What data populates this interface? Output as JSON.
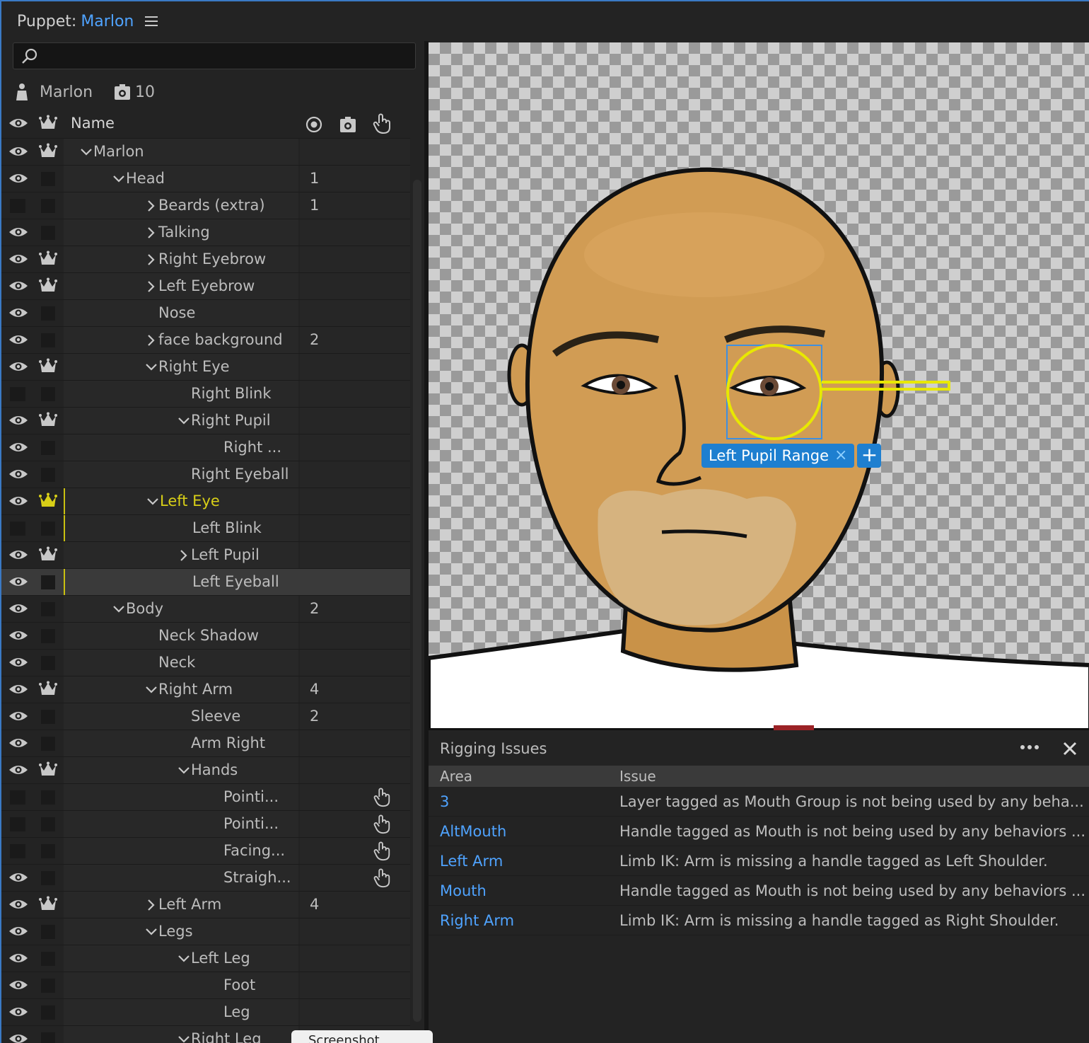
{
  "header": {
    "prefix": "Puppet:",
    "puppet_name": "Marlon"
  },
  "search": {
    "placeholder": ""
  },
  "puppet_info": {
    "name": "Marlon",
    "behaviors_count": "10"
  },
  "table": {
    "column_name": "Name",
    "rows": [
      {
        "label": "Marlon",
        "indent": 0,
        "chev": "down",
        "eye": true,
        "crown": true,
        "num": "",
        "hand": false
      },
      {
        "label": "Head",
        "indent": 1,
        "chev": "down",
        "eye": true,
        "crown": false,
        "num": "1",
        "hand": false
      },
      {
        "label": "Beards (extra)",
        "indent": 2,
        "chev": "right",
        "eye": false,
        "crown": false,
        "num": "1",
        "hand": false
      },
      {
        "label": "Talking",
        "indent": 2,
        "chev": "right",
        "eye": true,
        "crown": false,
        "num": "",
        "hand": false
      },
      {
        "label": "Right Eyebrow",
        "indent": 2,
        "chev": "right",
        "eye": true,
        "crown": true,
        "num": "",
        "hand": false
      },
      {
        "label": "Left Eyebrow",
        "indent": 2,
        "chev": "right",
        "eye": true,
        "crown": true,
        "num": "",
        "hand": false
      },
      {
        "label": "Nose",
        "indent": 2,
        "chev": "",
        "eye": true,
        "crown": false,
        "num": "",
        "hand": false
      },
      {
        "label": "face background",
        "indent": 2,
        "chev": "right",
        "eye": true,
        "crown": false,
        "num": "2",
        "hand": false
      },
      {
        "label": "Right Eye",
        "indent": 2,
        "chev": "down",
        "eye": true,
        "crown": true,
        "num": "",
        "hand": false
      },
      {
        "label": "Right Blink",
        "indent": 3,
        "chev": "",
        "eye": false,
        "crown": false,
        "num": "",
        "hand": false
      },
      {
        "label": "Right Pupil",
        "indent": 3,
        "chev": "down",
        "eye": true,
        "crown": true,
        "num": "",
        "hand": false
      },
      {
        "label": "Right ...",
        "indent": 4,
        "chev": "",
        "eye": true,
        "crown": false,
        "num": "",
        "hand": false
      },
      {
        "label": "Right Eyeball",
        "indent": 3,
        "chev": "",
        "eye": true,
        "crown": false,
        "num": "",
        "hand": false
      },
      {
        "label": "Left Eye",
        "indent": 2,
        "chev": "down",
        "eye": true,
        "crown": true,
        "crown_yellow": true,
        "yellow": true,
        "num": "",
        "hand": false
      },
      {
        "label": "Left Blink",
        "indent": 3,
        "chev": "",
        "eye": false,
        "crown": false,
        "yline": true,
        "num": "",
        "hand": false
      },
      {
        "label": "Left Pupil",
        "indent": 3,
        "chev": "right",
        "eye": true,
        "crown": true,
        "num": "",
        "hand": false
      },
      {
        "label": "Left Eyeball",
        "indent": 3,
        "chev": "",
        "eye": true,
        "crown": false,
        "selected": true,
        "yline": true,
        "num": "",
        "hand": false
      },
      {
        "label": "Body",
        "indent": 1,
        "chev": "down",
        "eye": true,
        "crown": false,
        "num": "2",
        "hand": false
      },
      {
        "label": "Neck Shadow",
        "indent": 2,
        "chev": "",
        "eye": true,
        "crown": false,
        "num": "",
        "hand": false
      },
      {
        "label": "Neck",
        "indent": 2,
        "chev": "",
        "eye": true,
        "crown": false,
        "num": "",
        "hand": false
      },
      {
        "label": "Right Arm",
        "indent": 2,
        "chev": "down",
        "eye": true,
        "crown": true,
        "num": "4",
        "hand": false
      },
      {
        "label": "Sleeve",
        "indent": 3,
        "chev": "",
        "eye": true,
        "crown": false,
        "num": "2",
        "hand": false
      },
      {
        "label": "Arm Right",
        "indent": 3,
        "chev": "",
        "eye": true,
        "crown": false,
        "num": "",
        "hand": false
      },
      {
        "label": "Hands",
        "indent": 3,
        "chev": "down",
        "eye": true,
        "crown": true,
        "num": "",
        "hand": false
      },
      {
        "label": "Pointi...",
        "indent": 4,
        "chev": "",
        "eye": false,
        "crown": false,
        "num": "",
        "hand": true
      },
      {
        "label": "Pointi...",
        "indent": 4,
        "chev": "",
        "eye": false,
        "crown": false,
        "num": "",
        "hand": true
      },
      {
        "label": "Facing...",
        "indent": 4,
        "chev": "",
        "eye": false,
        "crown": false,
        "num": "",
        "hand": true
      },
      {
        "label": "Straigh...",
        "indent": 4,
        "chev": "",
        "eye": true,
        "crown": false,
        "num": "",
        "hand": true
      },
      {
        "label": "Left Arm",
        "indent": 2,
        "chev": "right",
        "eye": true,
        "crown": true,
        "num": "4",
        "hand": false
      },
      {
        "label": "Legs",
        "indent": 2,
        "chev": "down",
        "eye": true,
        "crown": false,
        "num": "",
        "hand": false
      },
      {
        "label": "Left Leg",
        "indent": 3,
        "chev": "down",
        "eye": true,
        "crown": false,
        "num": "",
        "hand": false
      },
      {
        "label": "Foot",
        "indent": 4,
        "chev": "",
        "eye": true,
        "crown": false,
        "num": "",
        "hand": false
      },
      {
        "label": "Leg",
        "indent": 4,
        "chev": "",
        "eye": true,
        "crown": false,
        "num": "",
        "hand": false
      },
      {
        "label": "Right Leg",
        "indent": 3,
        "chev": "down",
        "eye": true,
        "crown": false,
        "num": "",
        "hand": false
      }
    ]
  },
  "canvas": {
    "handle_tag": "Left Pupil Range",
    "tag_remove": "×",
    "tag_add": "+"
  },
  "issues": {
    "title": "Rigging Issues",
    "col_area": "Area",
    "col_issue": "Issue",
    "rows": [
      {
        "area": "3",
        "issue": "Layer tagged as Mouth Group is not being used by any beha..."
      },
      {
        "area": "AltMouth",
        "issue": "Handle tagged as Mouth is not being used by any behaviors ..."
      },
      {
        "area": "Left Arm",
        "issue": "Limb IK: Arm is missing a handle tagged as Left Shoulder."
      },
      {
        "area": "Mouth",
        "issue": "Handle tagged as Mouth is not being used by any behaviors ..."
      },
      {
        "area": "Right Arm",
        "issue": "Limb IK: Arm is missing a handle tagged as Right Shoulder."
      }
    ]
  },
  "tooltip": {
    "text": "Screenshot"
  },
  "colors": {
    "accent": "#4fa3ff",
    "selection_yellow": "#d8cf17",
    "tag_blue": "#1e7fd0"
  }
}
